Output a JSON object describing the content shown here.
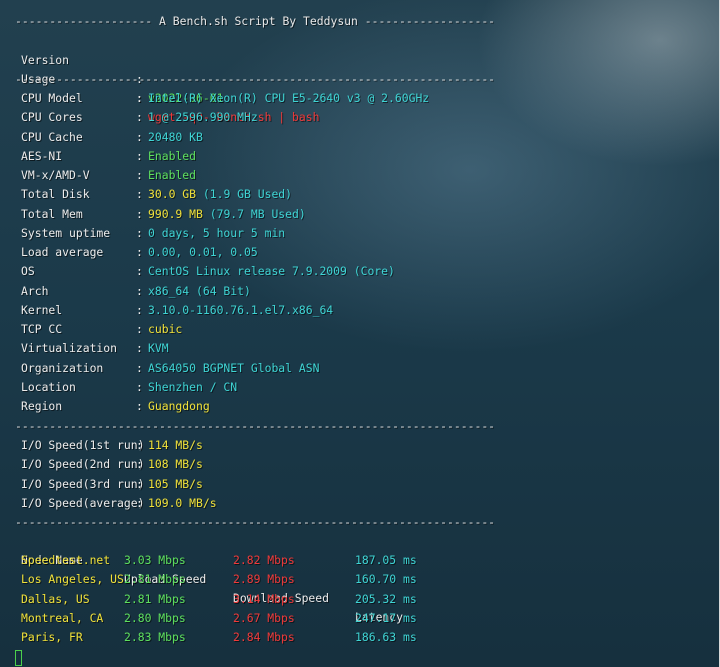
{
  "header": {
    "title_line": "-------------------- A Bench.sh Script By Teddysun -------------------"
  },
  "separator": "----------------------------------------------------------------------",
  "version": {
    "label": "Version",
    "value": "v2022-06-01"
  },
  "usage": {
    "label": "Usage",
    "value": "wget -qO- bench.sh | bash"
  },
  "system": [
    {
      "label": "CPU Model",
      "value": "Intel(R) Xeon(R) CPU E5-2640 v3 @ 2.60GHz",
      "extra": "",
      "color": "cyan"
    },
    {
      "label": "CPU Cores",
      "value": "1 @ 2596.990 MHz",
      "extra": "",
      "color": "cyan"
    },
    {
      "label": "CPU Cache",
      "value": "20480 KB",
      "extra": "",
      "color": "cyan"
    },
    {
      "label": "AES-NI",
      "value": "Enabled",
      "extra": "",
      "color": "green"
    },
    {
      "label": "VM-x/AMD-V",
      "value": "Enabled",
      "extra": "",
      "color": "green"
    },
    {
      "label": "Total Disk",
      "value": "30.0 GB",
      "extra": " (1.9 GB Used)",
      "color": "yellow"
    },
    {
      "label": "Total Mem",
      "value": "990.9 MB",
      "extra": " (79.7 MB Used)",
      "color": "yellow"
    },
    {
      "label": "System uptime",
      "value": "0 days, 5 hour 5 min",
      "extra": "",
      "color": "cyan"
    },
    {
      "label": "Load average",
      "value": "0.00, 0.01, 0.05",
      "extra": "",
      "color": "cyan"
    },
    {
      "label": "OS",
      "value": "CentOS Linux release 7.9.2009 (Core)",
      "extra": "",
      "color": "cyan"
    },
    {
      "label": "Arch",
      "value": "x86_64 (64 Bit)",
      "extra": "",
      "color": "cyan"
    },
    {
      "label": "Kernel",
      "value": "3.10.0-1160.76.1.el7.x86_64",
      "extra": "",
      "color": "cyan"
    },
    {
      "label": "TCP CC",
      "value": "cubic",
      "extra": "",
      "color": "yellow"
    },
    {
      "label": "Virtualization",
      "value": "KVM",
      "extra": "",
      "color": "cyan"
    },
    {
      "label": "Organization",
      "value": "AS64050 BGPNET Global ASN",
      "extra": "",
      "color": "cyan"
    },
    {
      "label": "Location",
      "value": "Shenzhen / CN",
      "extra": "",
      "color": "cyan"
    },
    {
      "label": "Region",
      "value": "Guangdong",
      "extra": "",
      "color": "yellow"
    }
  ],
  "io": [
    {
      "label": "I/O Speed(1st run)",
      "value": "114 MB/s"
    },
    {
      "label": "I/O Speed(2nd run)",
      "value": "108 MB/s"
    },
    {
      "label": "I/O Speed(3rd run)",
      "value": "105 MB/s"
    },
    {
      "label": "I/O Speed(average)",
      "value": "109.0 MB/s"
    }
  ],
  "speedtest": {
    "headers": [
      "Node Name",
      "Upload Speed",
      "Download Speed",
      "Latency"
    ],
    "rows": [
      {
        "node": "Speedtest.net",
        "upload": "3.03 Mbps",
        "download": "2.82 Mbps",
        "latency": "187.05 ms"
      },
      {
        "node": "Los Angeles, US",
        "upload": "2.81 Mbps",
        "download": "2.89 Mbps",
        "latency": "160.70 ms"
      },
      {
        "node": "Dallas, US",
        "upload": "2.81 Mbps",
        "download": "3.14 Mbps",
        "latency": "205.32 ms"
      },
      {
        "node": "Montreal, CA",
        "upload": "2.80 Mbps",
        "download": "2.67 Mbps",
        "latency": "247.17 ms"
      },
      {
        "node": "Paris, FR",
        "upload": "2.83 Mbps",
        "download": "2.84 Mbps",
        "latency": "186.63 ms"
      }
    ]
  },
  "colors": {
    "green": "#5ee05e",
    "red": "#f03a3a",
    "cyan": "#3fd4d4",
    "yellow": "#f0e13a"
  }
}
